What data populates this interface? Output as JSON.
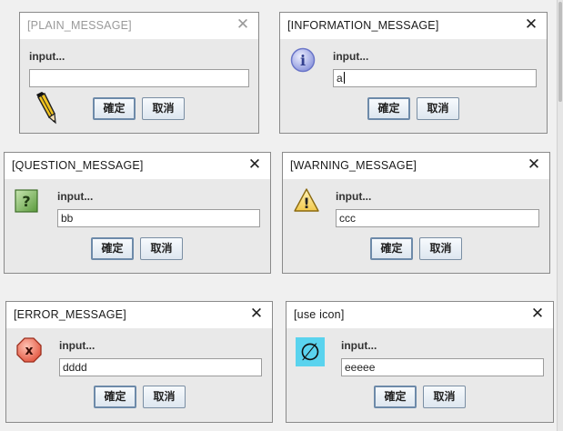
{
  "prompt_text": "input...",
  "ok_label": "確定",
  "cancel_label": "取消",
  "dialogs": [
    {
      "title": "[PLAIN_MESSAGE]",
      "value": "",
      "icon": "pencil-icon"
    },
    {
      "title": "[INFORMATION_MESSAGE]",
      "value": "a",
      "icon": "information-icon"
    },
    {
      "title": "[QUESTION_MESSAGE]",
      "value": "bb",
      "icon": "question-icon"
    },
    {
      "title": "[WARNING_MESSAGE]",
      "value": "ccc",
      "icon": "warning-icon"
    },
    {
      "title": "[ERROR_MESSAGE]",
      "value": "dddd",
      "icon": "error-icon"
    },
    {
      "title": "[use icon]",
      "value": "eeeee",
      "icon": "custom-empty-set-icon"
    }
  ],
  "icon_glyphs": {
    "information-icon": "i",
    "question-icon": "?",
    "warning-icon": "!",
    "error-icon": "x",
    "custom-empty-set-icon": "∅"
  },
  "colors": {
    "window_border": "#8a8a8a",
    "button_border": "#7a8ea3",
    "info_icon": "#6b76c8",
    "question_icon": "#5a9a3c",
    "warning_icon": "#f2c94c",
    "error_icon": "#e2553f",
    "custom_icon_bg": "#5ad3ee"
  }
}
